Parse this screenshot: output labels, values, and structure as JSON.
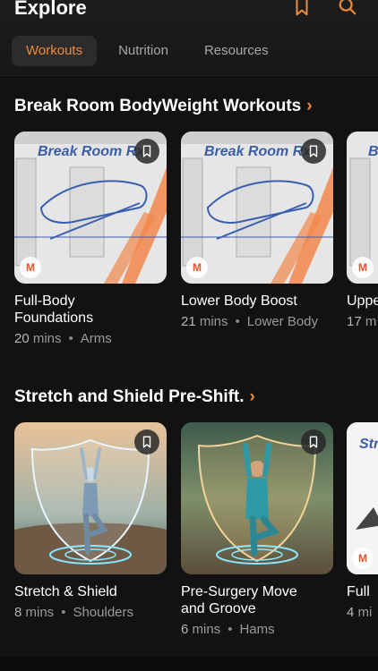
{
  "header": {
    "title": "Explore",
    "icons": [
      "bookmark-icon",
      "search-icon"
    ],
    "accent": "#f08a3a"
  },
  "tabs": [
    {
      "label": "Workouts",
      "active": true
    },
    {
      "label": "Nutrition",
      "active": false
    },
    {
      "label": "Resources",
      "active": false
    }
  ],
  "sections": [
    {
      "title": "Break Room BodyWeight Workouts",
      "cards": [
        {
          "title": "Full-Body\nFoundations",
          "mins": "20",
          "mins_label": "mins",
          "tag": "Arms",
          "image_text": "Break Room Rx"
        },
        {
          "title": "Lower Body Boost",
          "mins": "21",
          "mins_label": "mins",
          "tag": "Lower Body",
          "image_text": "Break Room Rx"
        },
        {
          "title": "Upper Body Card",
          "mins": "17",
          "mins_label": "m",
          "tag": "",
          "image_text": "B"
        }
      ]
    },
    {
      "title": "Stretch and Shield Pre-Shift.",
      "cards": [
        {
          "title": "Stretch & Shield",
          "mins": "8",
          "mins_label": "mins",
          "tag": "Shoulders"
        },
        {
          "title": "Pre-Surgery Move\nand Groove",
          "mins": "6",
          "mins_label": "mins",
          "tag": "Hams"
        },
        {
          "title": "Full",
          "mins": "4",
          "mins_label": "mi",
          "tag": "",
          "image_text": "Str"
        }
      ]
    }
  ],
  "brand_mark": "M",
  "colors": {
    "background": "#121212",
    "accent": "#f08a3a",
    "meta_text": "#9a9a9a"
  }
}
